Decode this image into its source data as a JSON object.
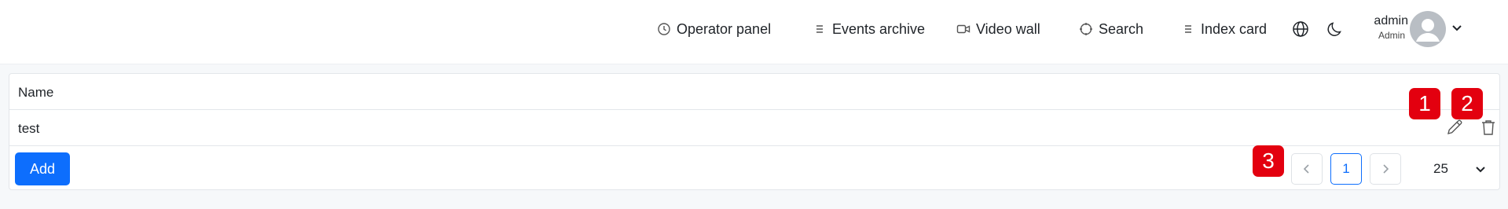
{
  "nav": {
    "operator_panel": "Operator panel",
    "events_archive": "Events archive",
    "video_wall": "Video wall",
    "search": "Search",
    "index_card": "Index card"
  },
  "icons": {
    "operator_panel": "clock-icon",
    "events_archive": "list-icon",
    "video_wall": "video-camera-icon",
    "search": "crosshair-icon",
    "index_card": "list-icon",
    "language": "globe-icon",
    "theme": "moon-icon",
    "user_menu": "chevron-down-icon",
    "edit": "pencil-icon",
    "delete": "trash-icon"
  },
  "user": {
    "name": "admin",
    "role": "Admin"
  },
  "table": {
    "columns": [
      "Name"
    ],
    "rows": [
      {
        "name": "test"
      }
    ]
  },
  "actions": {
    "add_label": "Add"
  },
  "pagination": {
    "current_page": "1",
    "page_size": "25"
  },
  "markers": [
    "1",
    "2",
    "3"
  ],
  "colors": {
    "primary": "#0d6efd",
    "marker": "#e3000f"
  }
}
